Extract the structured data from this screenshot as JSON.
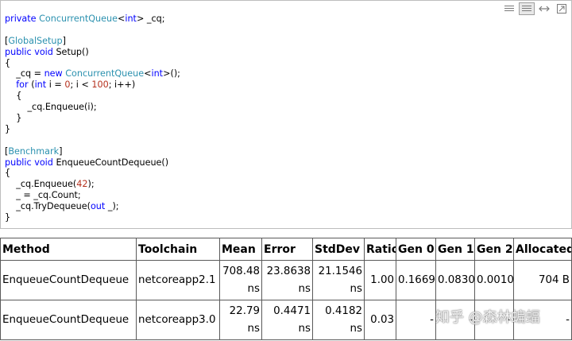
{
  "toolbar": {
    "icons": [
      "view-source-icon",
      "copy-icon",
      "expand-icon",
      "popout-icon"
    ]
  },
  "code": {
    "lines": [
      [
        [
          "kw",
          "private "
        ],
        [
          "ty",
          "ConcurrentQueue"
        ],
        [
          "pun",
          "<"
        ],
        [
          "kw",
          "int"
        ],
        [
          "pun",
          "> _cq;"
        ]
      ],
      [],
      [
        [
          "pun",
          "["
        ],
        [
          "attr",
          "GlobalSetup"
        ],
        [
          "pun",
          "]"
        ]
      ],
      [
        [
          "kw",
          "public void "
        ],
        [
          "pun",
          "Setup()"
        ]
      ],
      [
        [
          "pun",
          "{"
        ]
      ],
      [
        [
          "pun",
          "    _cq = "
        ],
        [
          "kw",
          "new "
        ],
        [
          "ty",
          "ConcurrentQueue"
        ],
        [
          "pun",
          "<"
        ],
        [
          "kw",
          "int"
        ],
        [
          "pun",
          ">();"
        ]
      ],
      [
        [
          "pun",
          "    "
        ],
        [
          "kw",
          "for "
        ],
        [
          "pun",
          "("
        ],
        [
          "kw",
          "int "
        ],
        [
          "pun",
          "i = "
        ],
        [
          "num",
          "0"
        ],
        [
          "pun",
          "; i < "
        ],
        [
          "num",
          "100"
        ],
        [
          "pun",
          "; i++)"
        ]
      ],
      [
        [
          "pun",
          "    {"
        ]
      ],
      [
        [
          "pun",
          "        _cq.Enqueue(i);"
        ]
      ],
      [
        [
          "pun",
          "    }"
        ]
      ],
      [
        [
          "pun",
          "}"
        ]
      ],
      [],
      [
        [
          "pun",
          "["
        ],
        [
          "attr",
          "Benchmark"
        ],
        [
          "pun",
          "]"
        ]
      ],
      [
        [
          "kw",
          "public void "
        ],
        [
          "pun",
          "EnqueueCountDequeue()"
        ]
      ],
      [
        [
          "pun",
          "{"
        ]
      ],
      [
        [
          "pun",
          "    _cq.Enqueue("
        ],
        [
          "num",
          "42"
        ],
        [
          "pun",
          ");"
        ]
      ],
      [
        [
          "pun",
          "    _ = _cq.Count;"
        ]
      ],
      [
        [
          "pun",
          "    _cq.TryDequeue("
        ],
        [
          "kw",
          "out "
        ],
        [
          "pun",
          "_);"
        ]
      ],
      [
        [
          "pun",
          "}"
        ]
      ]
    ]
  },
  "results": {
    "headers": [
      "Method",
      "Toolchain",
      "Mean",
      "Error",
      "StdDev",
      "Ratio",
      "Gen 0",
      "Gen 1",
      "Gen 2",
      "Allocated"
    ],
    "rows": [
      {
        "method": "EnqueueCountDequeue",
        "toolchain": "netcoreapp2.1",
        "mean": [
          "708.48",
          "ns"
        ],
        "error": [
          "23.8638",
          "ns"
        ],
        "stddev": [
          "21.1546",
          "ns"
        ],
        "ratio": "1.00",
        "gen0": "0.1669",
        "gen1": "0.0830",
        "gen2": "0.0010",
        "allocated": "704 B"
      },
      {
        "method": "EnqueueCountDequeue",
        "toolchain": "netcoreapp3.0",
        "mean": [
          "22.79",
          "ns"
        ],
        "error": [
          "0.4471",
          "ns"
        ],
        "stddev": [
          "0.4182",
          "ns"
        ],
        "ratio": "0.03",
        "gen0": "-",
        "gen1": "-",
        "gen2": "-",
        "allocated": "-"
      }
    ]
  },
  "watermark": "知乎 @森林蝙蝠"
}
